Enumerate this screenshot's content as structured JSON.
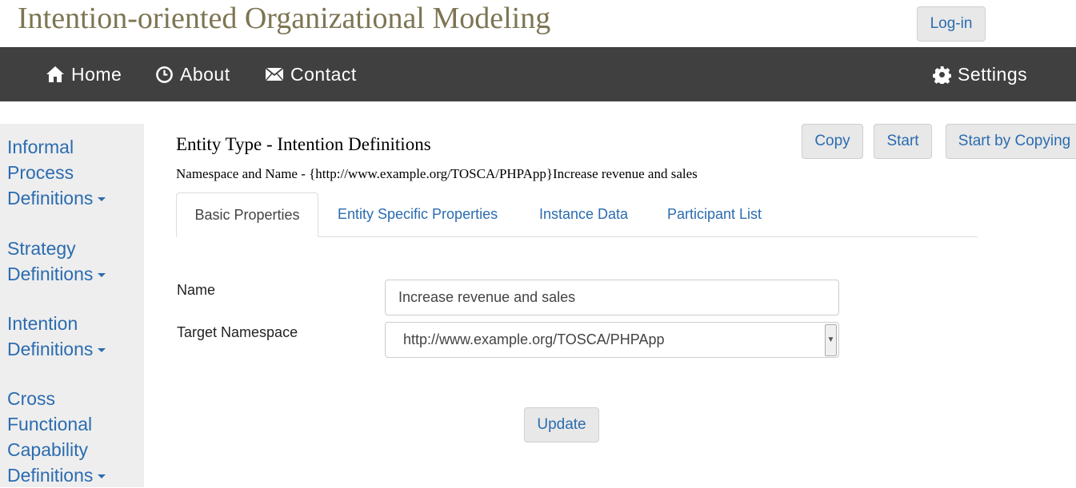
{
  "header": {
    "app_title": "Intention-oriented Organizational Modeling",
    "login_label": "Log-in"
  },
  "navbar": {
    "items": [
      {
        "label": "Home",
        "icon": "home-icon"
      },
      {
        "label": "About",
        "icon": "clock-icon"
      },
      {
        "label": "Contact",
        "icon": "envelope-icon"
      }
    ],
    "settings": {
      "label": "Settings",
      "icon": "gear-icon"
    }
  },
  "sidebar": {
    "items": [
      {
        "label": "Informal Process Definitions"
      },
      {
        "label": "Strategy Definitions"
      },
      {
        "label": "Intention Definitions"
      },
      {
        "label": "Cross Functional Capability Definitions"
      }
    ]
  },
  "main": {
    "title": "Entity Type - Intention Definitions",
    "namespace_line": "Namespace and Name - {http://www.example.org/TOSCA/PHPApp}Increase revenue and sales",
    "actions": {
      "copy": "Copy",
      "start": "Start",
      "start_by_copying": "Start by Copying"
    },
    "tabs": [
      {
        "label": "Basic Properties",
        "active": true
      },
      {
        "label": "Entity Specific Properties",
        "active": false
      },
      {
        "label": "Instance Data",
        "active": false
      },
      {
        "label": "Participant List",
        "active": false
      }
    ],
    "form": {
      "name_label": "Name",
      "name_value": "Increase revenue and sales",
      "namespace_label": "Target Namespace",
      "namespace_value": "http://www.example.org/TOSCA/PHPApp",
      "update_label": "Update"
    }
  },
  "colors": {
    "navbar_bg": "#404040",
    "link": "#2b6cb0",
    "title": "#7d7553",
    "sidebar_bg": "#eeeeee"
  }
}
